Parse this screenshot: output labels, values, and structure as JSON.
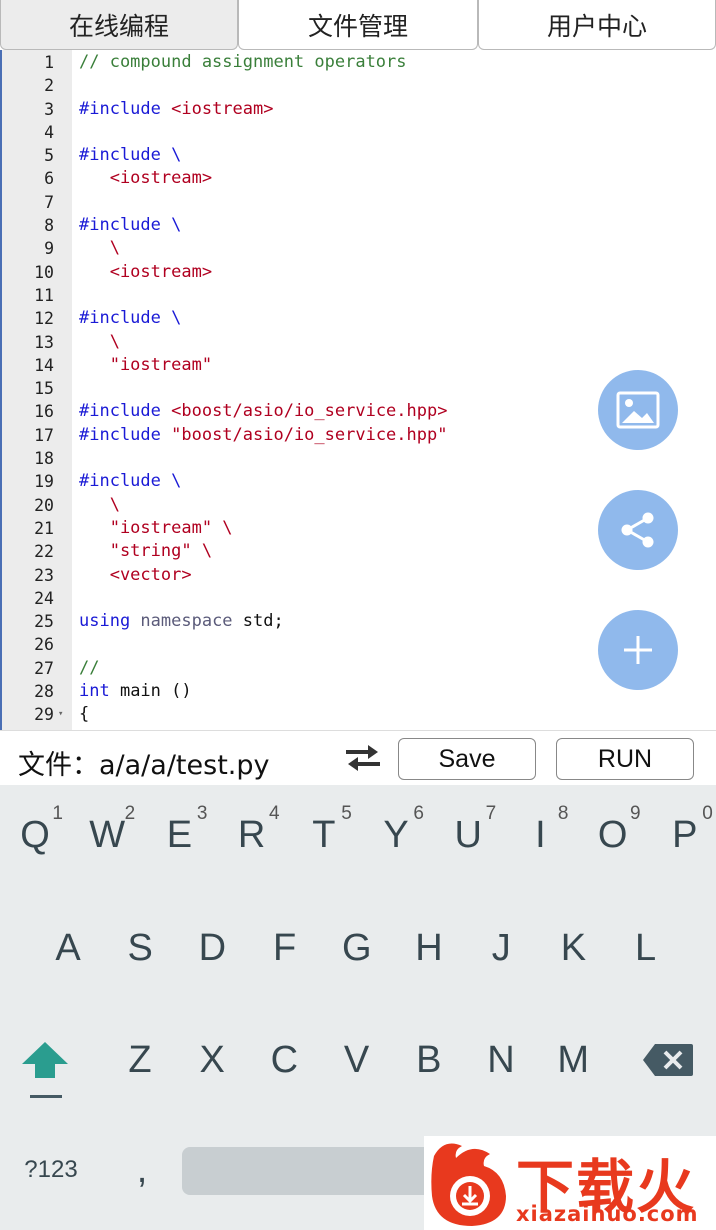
{
  "tabs": [
    {
      "label": "在线编程",
      "active": true
    },
    {
      "label": "文件管理",
      "active": false
    },
    {
      "label": "用户中心",
      "active": false
    }
  ],
  "editor": {
    "lines": [
      {
        "n": "1",
        "parts": [
          {
            "t": "// compound assignment operators",
            "c": "comment"
          }
        ]
      },
      {
        "n": "2",
        "parts": []
      },
      {
        "n": "3",
        "parts": [
          {
            "t": "#include ",
            "c": "directive"
          },
          {
            "t": "<iostream>",
            "c": "string"
          }
        ]
      },
      {
        "n": "4",
        "parts": []
      },
      {
        "n": "5",
        "parts": [
          {
            "t": "#include \\",
            "c": "directive"
          }
        ]
      },
      {
        "n": "6",
        "parts": [
          {
            "t": "   <iostream>",
            "c": "string"
          }
        ]
      },
      {
        "n": "7",
        "parts": []
      },
      {
        "n": "8",
        "parts": [
          {
            "t": "#include \\",
            "c": "directive"
          }
        ]
      },
      {
        "n": "9",
        "parts": [
          {
            "t": "   \\",
            "c": "string"
          }
        ]
      },
      {
        "n": "10",
        "parts": [
          {
            "t": "   <iostream>",
            "c": "string"
          }
        ]
      },
      {
        "n": "11",
        "parts": []
      },
      {
        "n": "12",
        "parts": [
          {
            "t": "#include \\",
            "c": "directive"
          }
        ]
      },
      {
        "n": "13",
        "parts": [
          {
            "t": "   \\",
            "c": "string"
          }
        ]
      },
      {
        "n": "14",
        "parts": [
          {
            "t": "   \"iostream\"",
            "c": "string"
          }
        ]
      },
      {
        "n": "15",
        "parts": []
      },
      {
        "n": "16",
        "parts": [
          {
            "t": "#include ",
            "c": "directive"
          },
          {
            "t": "<boost/asio/io_service.hpp>",
            "c": "string"
          }
        ]
      },
      {
        "n": "17",
        "parts": [
          {
            "t": "#include ",
            "c": "directive"
          },
          {
            "t": "\"boost/asio/io_service.hpp\"",
            "c": "string"
          }
        ]
      },
      {
        "n": "18",
        "parts": []
      },
      {
        "n": "19",
        "parts": [
          {
            "t": "#include \\",
            "c": "directive"
          }
        ]
      },
      {
        "n": "20",
        "parts": [
          {
            "t": "   \\",
            "c": "string"
          }
        ]
      },
      {
        "n": "21",
        "parts": [
          {
            "t": "   \"iostream\" \\",
            "c": "string"
          }
        ]
      },
      {
        "n": "22",
        "parts": [
          {
            "t": "   \"string\" \\",
            "c": "string"
          }
        ]
      },
      {
        "n": "23",
        "parts": [
          {
            "t": "   <vector>",
            "c": "string"
          }
        ]
      },
      {
        "n": "24",
        "parts": []
      },
      {
        "n": "25",
        "parts": [
          {
            "t": "using ",
            "c": "keyword"
          },
          {
            "t": "namespace ",
            "c": "ns"
          },
          {
            "t": "std;",
            "c": "plain"
          }
        ]
      },
      {
        "n": "26",
        "parts": []
      },
      {
        "n": "27",
        "parts": [
          {
            "t": "//",
            "c": "comment"
          }
        ]
      },
      {
        "n": "28",
        "parts": [
          {
            "t": "int ",
            "c": "keyword"
          },
          {
            "t": "main ()",
            "c": "plain"
          }
        ]
      },
      {
        "n": "29",
        "parts": [
          {
            "t": "{",
            "c": "plain"
          }
        ],
        "fold": "▾"
      }
    ]
  },
  "fabs": {
    "image": "image-icon",
    "share": "share-icon",
    "add": "plus-icon"
  },
  "statusbar": {
    "file_label": "文件：a/a/a/test.py",
    "swap_icon": "swap-arrows-icon",
    "save_label": "Save",
    "run_label": "RUN"
  },
  "keyboard": {
    "row1": [
      {
        "k": "Q",
        "h": "1"
      },
      {
        "k": "W",
        "h": "2"
      },
      {
        "k": "E",
        "h": "3"
      },
      {
        "k": "R",
        "h": "4"
      },
      {
        "k": "T",
        "h": "5"
      },
      {
        "k": "Y",
        "h": "6"
      },
      {
        "k": "U",
        "h": "7"
      },
      {
        "k": "I",
        "h": "8"
      },
      {
        "k": "O",
        "h": "9"
      },
      {
        "k": "P",
        "h": "0"
      }
    ],
    "row2": [
      "A",
      "S",
      "D",
      "F",
      "G",
      "H",
      "J",
      "K",
      "L"
    ],
    "row3": [
      "Z",
      "X",
      "C",
      "V",
      "B",
      "N",
      "M"
    ],
    "symbols_label": "?123",
    "comma_label": ",",
    "shift_icon": "shift-arrow-icon",
    "backspace_icon": "backspace-icon"
  },
  "watermark": {
    "logo_text": "下载火",
    "url": "xiazaihuo.com"
  },
  "colors": {
    "fab": "#90b9ec",
    "directive": "#1a1ad6",
    "string": "#b00020",
    "comment": "#3a7f3a",
    "watermark": "#e8391e"
  }
}
